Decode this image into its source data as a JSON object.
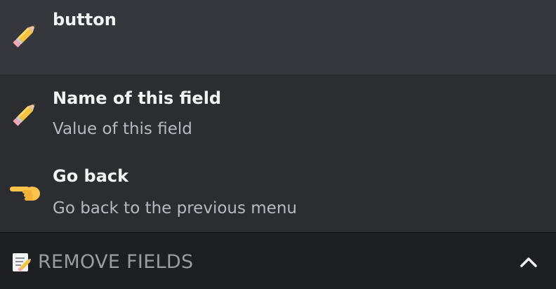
{
  "options": [
    {
      "label": "button",
      "description": "",
      "icon": "pencil-icon"
    },
    {
      "label": "Name of this field",
      "description": "Value of this field",
      "icon": "pencil-icon"
    },
    {
      "label": "Go back",
      "description": "Go back to the previous menu",
      "icon": "pointing-left-hand-icon"
    }
  ],
  "select": {
    "placeholder": "REMOVE FIELDS",
    "icon": "memo-icon",
    "expanded": true
  },
  "colors": {
    "background": "#2b2d31",
    "highlighted_option": "#36373d",
    "select_bar": "#1e1f22",
    "label_text": "#f2f3f5",
    "description_text": "#b5bac1",
    "placeholder_text": "#9a9ca1"
  }
}
